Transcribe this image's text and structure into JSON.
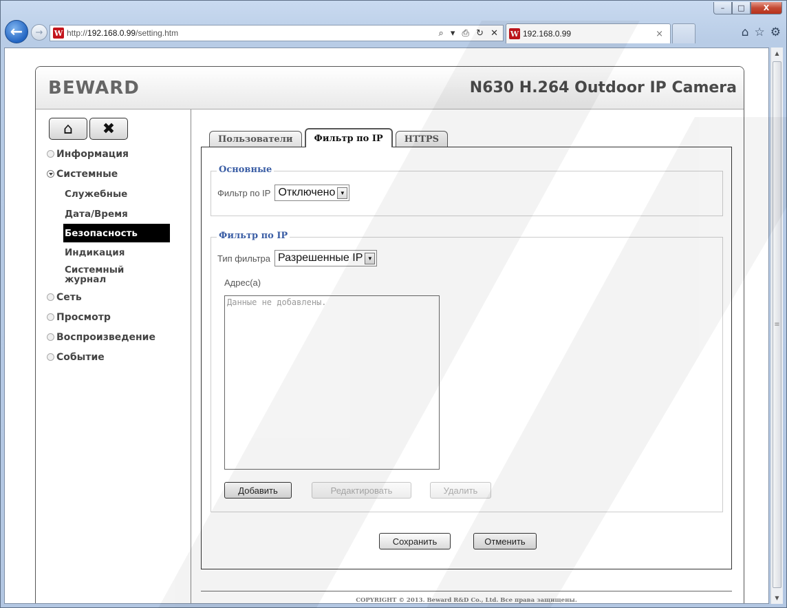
{
  "browser": {
    "url_prefix": "http://",
    "url_host": "192.168.0.99",
    "url_path": "/setting.htm",
    "addr_tools": "⌕ ▾ ⎙ ↻ ✕",
    "tab_title": "192.168.0.99",
    "tab_close": "×",
    "favicon_letter": "W",
    "window_min": "–",
    "window_max": "□",
    "window_close": "X"
  },
  "header": {
    "logo": "BEWARD",
    "camera_title": "N630 H.264 Outdoor IP Camera"
  },
  "sidebar": {
    "items": [
      {
        "label": "Информация"
      },
      {
        "label": "Системные"
      },
      {
        "label": "Служебные"
      },
      {
        "label": "Дата/Время"
      },
      {
        "label": "Безопасность"
      },
      {
        "label": "Индикация"
      },
      {
        "label": "Системный журнал"
      },
      {
        "label": "Сеть"
      },
      {
        "label": "Просмотр"
      },
      {
        "label": "Воспроизведение"
      },
      {
        "label": "Событие"
      }
    ]
  },
  "tabs": [
    {
      "label": "Пользователи"
    },
    {
      "label": "Фильтр по IP"
    },
    {
      "label": "HTTPS"
    }
  ],
  "basic": {
    "legend": "Основные",
    "filter_label": "Фильтр по IP",
    "filter_value": "Отключено"
  },
  "ipfilter": {
    "legend": "Фильтр по IP",
    "type_label": "Тип фильтра",
    "type_value": "Разрешенные IP",
    "addresses_label": "Адрес(а)",
    "addresses_empty": "Данные не добавлены.",
    "add": "Добавить",
    "edit": "Редактировать",
    "delete": "Удалить"
  },
  "actions": {
    "save": "Сохранить",
    "cancel": "Отменить"
  },
  "footer": {
    "copyright": "COPYRIGHT © 2013. Beward R&D Co., Ltd. Все права защищены."
  }
}
